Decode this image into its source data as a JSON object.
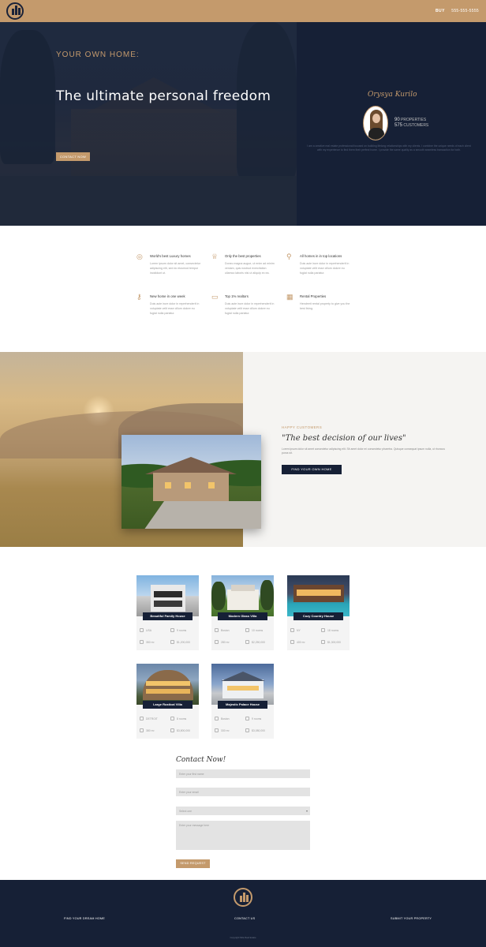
{
  "colors": {
    "gold": "#c49a6c",
    "navy": "#162036"
  },
  "nav": {
    "buy_label": "BUY",
    "phone": "555-555-5555"
  },
  "hero": {
    "kicker": "YOUR OWN HOME:",
    "title": "The ultimate personal freedom",
    "cta_label": "CONTACT NOW"
  },
  "agent": {
    "name": "Orysya Kurilo",
    "stats": [
      {
        "value": "90",
        "label": "PROPERTIES"
      },
      {
        "value": "575",
        "label": "CUSTOMERS"
      }
    ],
    "bio": "I am a creative real estate professional focused on building lifelong relationships with my clients. I combine the unique needs of each client with my experience to find them their perfect home. I provide the same quality as a smooth seamless transaction for both."
  },
  "features": [
    {
      "icon": "globe-icon",
      "title": "World's best Luxury homes",
      "text": "Lorem ipsum dolor sit amet, consectetur adipiscing elit, sed do eiusmod tempor incididunt ut."
    },
    {
      "icon": "trophy-icon",
      "title": "Only the best properties",
      "text": "Donec magna augue, ut enim ad minim veniam, quis nostrud exercitation ullamco laboris nisi ut aliquip ex ea."
    },
    {
      "icon": "location-pin-icon",
      "title": "All homes in in top locations",
      "text": "Duis aute irure dolor in reprehenderit in voluptate velit esse cillum dolore eu fugiat nulla pariatur."
    },
    {
      "icon": "key-icon",
      "title": "New home in one week",
      "text": "Duis aute irure dolor in reprehenderit in voluptate velit esse cillum dolore eu fugiat nulla pariatur."
    },
    {
      "icon": "monitor-icon",
      "title": "Top 1% realtors",
      "text": "Duis aute irure dolor in reprehenderit in voluptate velit esse cillum dolore eu fugiat nulla pariatur."
    },
    {
      "icon": "building-icon",
      "title": "Rental Properties",
      "text": "Hendrerit rental property to give you the best living."
    }
  ],
  "customers": {
    "kicker": "HAPPY CUSTOMERS",
    "title": "\"The best decision of our lives\"",
    "text": "Lorem ipsum dolor sit amet consectetur adipiscing elit. Sit amet dolor mi consectetur pharetra. Quisque consequat ipsum nulla, ut rhoncus purus sit.",
    "cta_label": "FIND YOUR OWN HOME"
  },
  "properties": [
    {
      "name": "Beautiful Family House",
      "location": "USA",
      "rooms": "9 rooms",
      "area": "350 m²",
      "price": "$1,200,000"
    },
    {
      "name": "Modern Glass Villa",
      "location": "Boston",
      "rooms": "10 rooms",
      "area": "280 m²",
      "price": "$2,250,000"
    },
    {
      "name": "Cozy Country House",
      "location": "NY",
      "rooms": "18 rooms",
      "area": "400 m²",
      "price": "$1,300,000"
    },
    {
      "name": "Large Rustical Villa",
      "location": "DETROIT",
      "rooms": "8 rooms",
      "area": "380 m²",
      "price": "$3,800,000"
    },
    {
      "name": "Majestic Palace House",
      "location": "Boston",
      "rooms": "9 rooms",
      "area": "330 m²",
      "price": "$3,080,000"
    }
  ],
  "contact": {
    "title": "Contact Now!",
    "first_name_placeholder": "Enter your first name",
    "email_placeholder": "Enter your email",
    "select_value": "Select one",
    "message_placeholder": "Enter your message here",
    "send_label": "SEND REQUEST"
  },
  "footer": {
    "links": [
      "FIND YOUR DREAM HOME",
      "CONTACT US",
      "SUBMIT YOUR PROPERTY"
    ],
    "copyright": "Copyright Mila Real Estate"
  }
}
